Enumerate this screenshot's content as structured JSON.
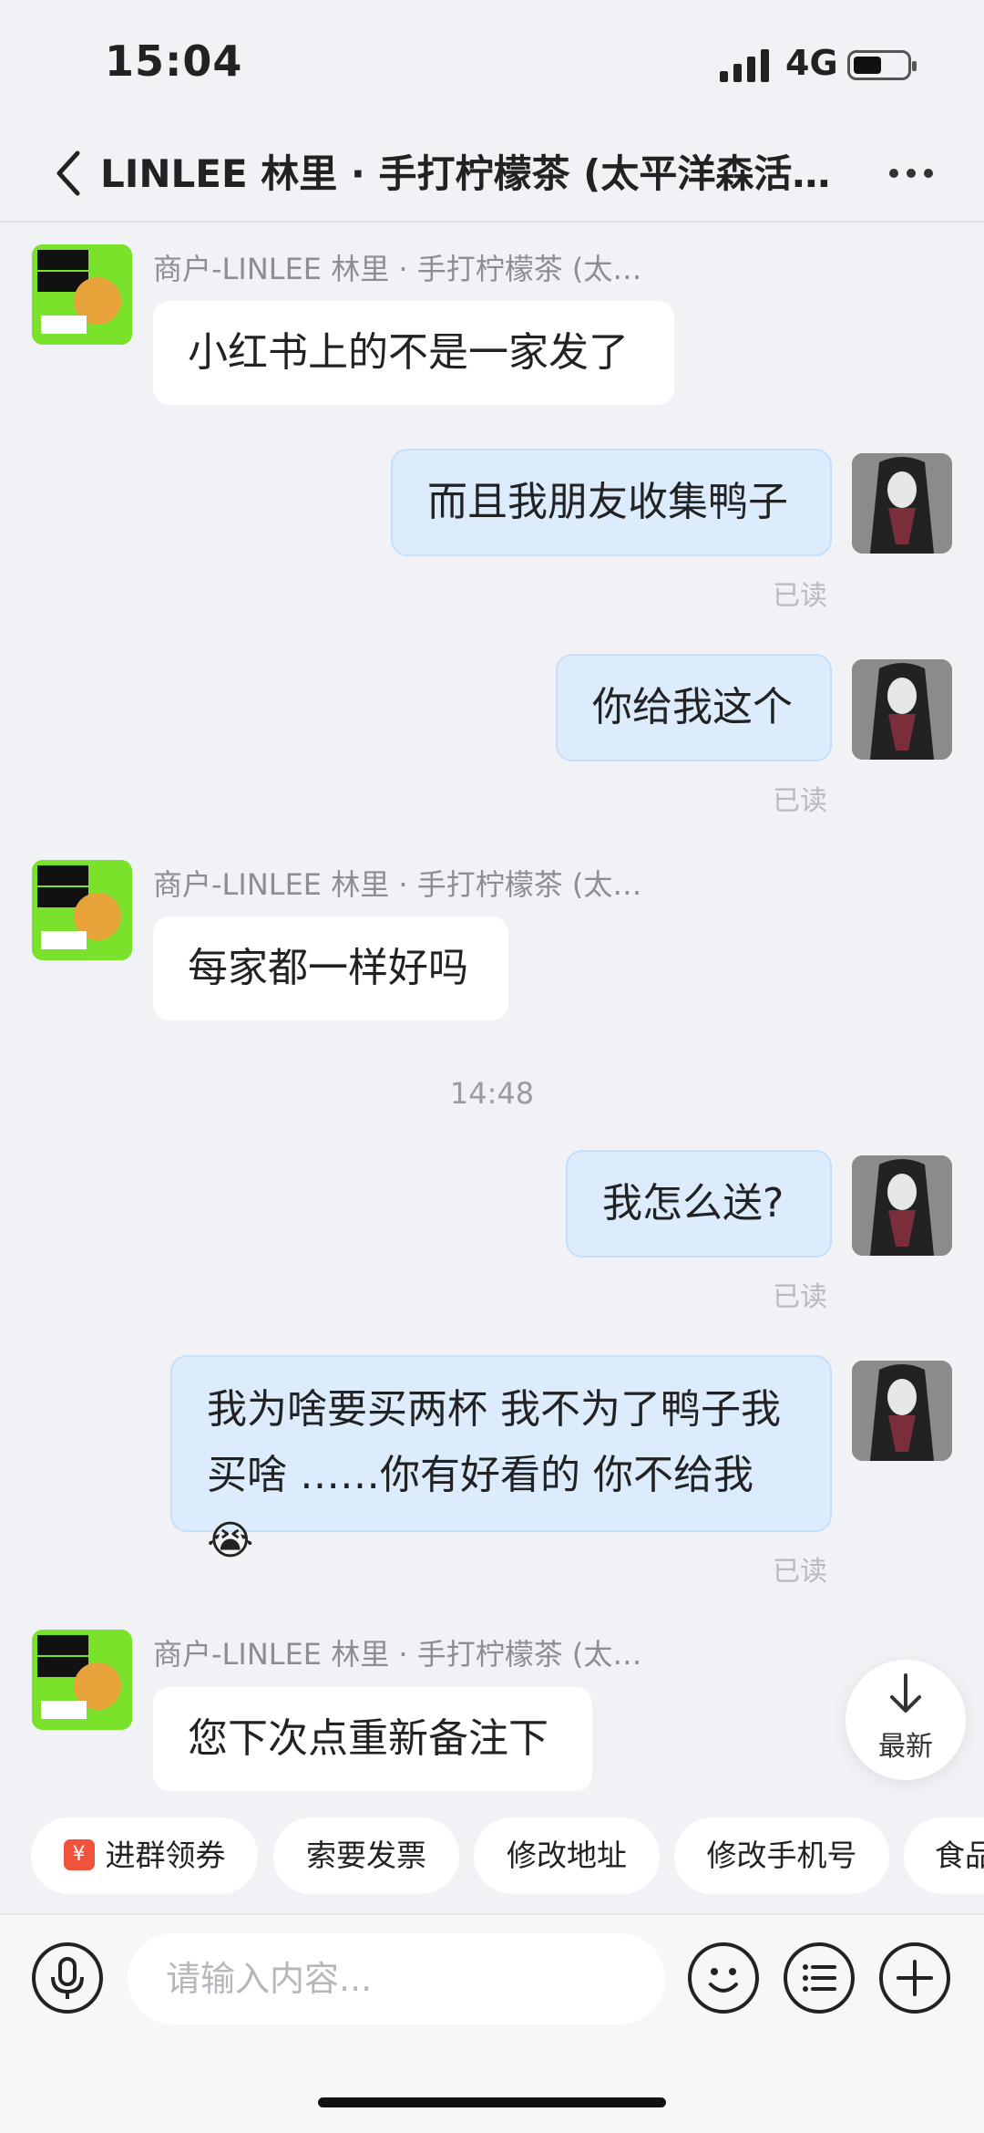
{
  "status_bar": {
    "time": "15:04",
    "network": "4G"
  },
  "header": {
    "title": "LINLEE 林里 · 手打柠檬茶 (太平洋森活…"
  },
  "messages": [
    {
      "sender": "商户-LINLEE 林里 · 手打柠檬茶 (太…",
      "text": "小红书上的不是一家发了"
    },
    {
      "text": "而且我朋友收集鸭子",
      "read": "已读"
    },
    {
      "text": "你给我这个",
      "read": "已读"
    },
    {
      "sender": "商户-LINLEE 林里 · 手打柠檬茶 (太…",
      "text": "每家都一样好吗"
    },
    {
      "text": "我怎么送?",
      "read": "已读"
    },
    {
      "text_line1": "我为啥要买两杯 我不为了鸭子我",
      "text_line2": "买啥 ……你有好看的 你不给我😭",
      "read": "已读"
    },
    {
      "sender": "商户-LINLEE 林里 · 手打柠檬茶 (太…",
      "text": "您下次点重新备注下"
    }
  ],
  "timestamp": "14:48",
  "newest_label": "最新",
  "quick_actions": [
    "进群领券",
    "索要发票",
    "修改地址",
    "修改手机号",
    "食品"
  ],
  "coupon_icon_glyph": "¥",
  "input": {
    "placeholder": "请输入内容..."
  },
  "icons": [
    "back-icon",
    "more-icon",
    "microphone-icon",
    "emoji-icon",
    "menu-list-icon",
    "plus-icon",
    "arrow-down-icon",
    "signal-icon",
    "battery-icon"
  ]
}
